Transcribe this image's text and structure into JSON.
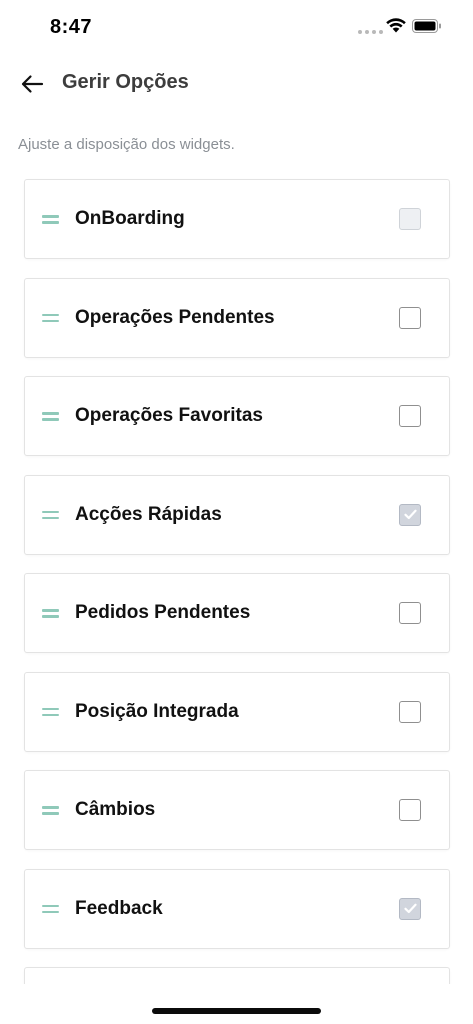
{
  "status_bar": {
    "time": "8:47",
    "icons": [
      "signal-dots-icon",
      "wifi-icon",
      "battery-icon"
    ]
  },
  "header": {
    "back_icon": "arrow-left-icon",
    "title": "Gerir Opções"
  },
  "subtitle": "Ajuste a disposição dos widgets.",
  "colors": {
    "handle": "#8fc9b9",
    "checkbox_border": "#8f8f8f",
    "checkbox_checked_bg": "#d1d5dd",
    "title_text": "#3d3d3d",
    "subtitle_text": "#8a8f95"
  },
  "widgets": [
    {
      "label": "OnBoarding",
      "state": "disabled"
    },
    {
      "label": "Operações Pendentes",
      "state": "unchecked"
    },
    {
      "label": "Operações Favoritas",
      "state": "unchecked"
    },
    {
      "label": "Acções Rápidas",
      "state": "checked"
    },
    {
      "label": "Pedidos Pendentes",
      "state": "unchecked"
    },
    {
      "label": "Posição Integrada",
      "state": "unchecked"
    },
    {
      "label": "Câmbios",
      "state": "unchecked"
    },
    {
      "label": "Feedback",
      "state": "checked"
    }
  ]
}
